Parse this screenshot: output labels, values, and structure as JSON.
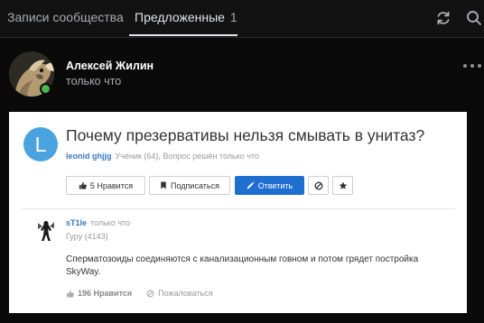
{
  "tabs": [
    {
      "label": "Записи сообщества"
    },
    {
      "label": "Предложенные",
      "count": "1"
    }
  ],
  "icons": {
    "refresh": "refresh-icon",
    "search": "search-icon",
    "more": "more-horizontal-icon"
  },
  "post": {
    "author": "Алексей Жилин",
    "time": "только что",
    "online": true,
    "accent_color": "#4bb34b"
  },
  "screenshot": {
    "avatar_letter": "L",
    "avatar_color": "#4aa3df",
    "title": "Почему презервативы нельзя смывать в унитаз?",
    "username": "leonid ghjjg",
    "user_meta": "Ученик (64), Вопрос решён только что",
    "buttons": {
      "like": "5 Нравится",
      "subscribe": "Подписаться",
      "answer": "Ответить"
    },
    "answer": {
      "nick": "sT1le",
      "time": "только что",
      "rank": "Гуру (4143)",
      "text": "Сперматозоиды соединяются с канализационным говном и потом грядет постройка SkyWay.",
      "likes": "196 Нравится",
      "report": "Пожаловаться"
    },
    "primary_color": "#1f6fd1"
  }
}
